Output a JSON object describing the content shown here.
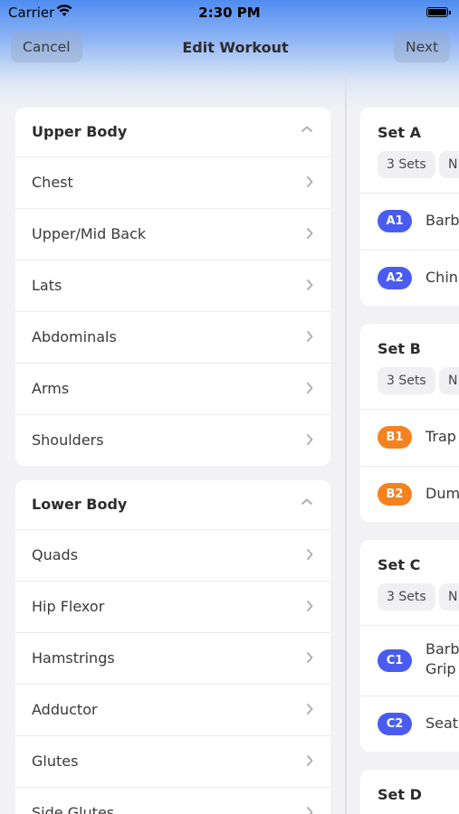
{
  "status_bar": {
    "carrier": "Carrier",
    "time": "2:30 PM"
  },
  "nav": {
    "title": "Edit Workout",
    "cancel_label": "Cancel",
    "next_label": "Next"
  },
  "colors": {
    "accent_blue": "#4a5cf0",
    "accent_orange": "#f5821f",
    "header_blue": "#4f8cf0"
  },
  "muscle_groups": [
    {
      "title": "Upper Body",
      "items": [
        "Chest",
        "Upper/Mid Back",
        "Lats",
        "Abdominals",
        "Arms",
        "Shoulders"
      ]
    },
    {
      "title": "Lower Body",
      "items": [
        "Quads",
        "Hip Flexor",
        "Hamstrings",
        "Adductor",
        "Glutes",
        "Side Glutes"
      ]
    }
  ],
  "sets": [
    {
      "title": "Set A",
      "chips": [
        "3 Sets",
        "N"
      ],
      "exercises": [
        {
          "badge": "A1",
          "name": "Barb"
        },
        {
          "badge": "A2",
          "name": "Chin"
        }
      ]
    },
    {
      "title": "Set B",
      "chips": [
        "3 Sets",
        "N"
      ],
      "exercises": [
        {
          "badge": "B1",
          "name": "Trap"
        },
        {
          "badge": "B2",
          "name": "Dum"
        }
      ]
    },
    {
      "title": "Set C",
      "chips": [
        "3 Sets",
        "N"
      ],
      "exercises": [
        {
          "badge": "C1",
          "name": "Barb",
          "name_line2": "Grip"
        },
        {
          "badge": "C2",
          "name": "Seat"
        }
      ]
    },
    {
      "title": "Set D"
    }
  ]
}
